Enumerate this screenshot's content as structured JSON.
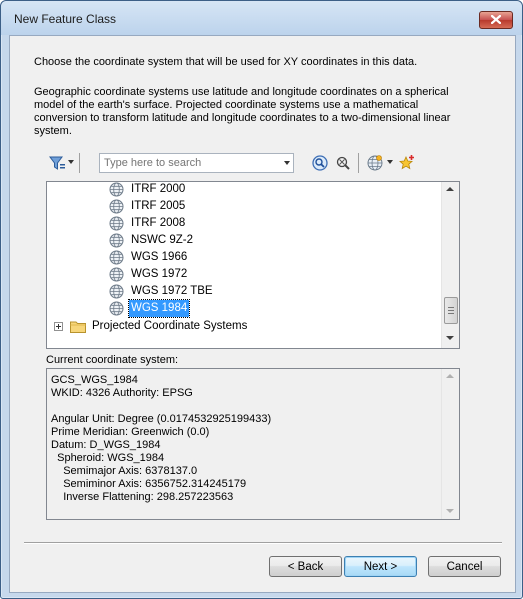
{
  "window": {
    "title": "New Feature Class"
  },
  "intro": {
    "line": "Choose the coordinate system that will be used for XY coordinates in this data.",
    "description": "Geographic coordinate systems use latitude and longitude coordinates on a spherical model of the earth's surface. Projected coordinate systems use a mathematical conversion to transform latitude and longitude coordinates to a two-dimensional linear system."
  },
  "toolbar": {
    "search_placeholder": "Type here to search",
    "icons": [
      "filter-icon",
      "search-icon",
      "clear-search-icon",
      "globe-icon",
      "add-favorite-icon"
    ]
  },
  "tree": {
    "items": [
      {
        "label": "ITRF 2000",
        "selected": false
      },
      {
        "label": "ITRF 2005",
        "selected": false
      },
      {
        "label": "ITRF 2008",
        "selected": false
      },
      {
        "label": "NSWC 9Z-2",
        "selected": false
      },
      {
        "label": "WGS 1966",
        "selected": false
      },
      {
        "label": "WGS 1972",
        "selected": false
      },
      {
        "label": "WGS 1972 TBE",
        "selected": false
      },
      {
        "label": "WGS 1984",
        "selected": true
      }
    ],
    "folder": {
      "label": "Projected Coordinate Systems",
      "expanded": false
    }
  },
  "current": {
    "label": "Current coordinate system:",
    "lines": [
      "GCS_WGS_1984",
      "WKID: 4326 Authority: EPSG",
      "",
      "Angular Unit: Degree (0.0174532925199433)",
      "Prime Meridian: Greenwich (0.0)",
      "Datum: D_WGS_1984",
      "  Spheroid: WGS_1984",
      "    Semimajor Axis: 6378137.0",
      "    Semiminor Axis: 6356752.314245179",
      "    Inverse Flattening: 298.257223563"
    ]
  },
  "buttons": {
    "back": "< Back",
    "next": "Next >",
    "cancel": "Cancel"
  },
  "colors": {
    "selection": "#3399ff",
    "dialog_bg": "#f0f0f0",
    "frame": "#c6d8ec"
  }
}
